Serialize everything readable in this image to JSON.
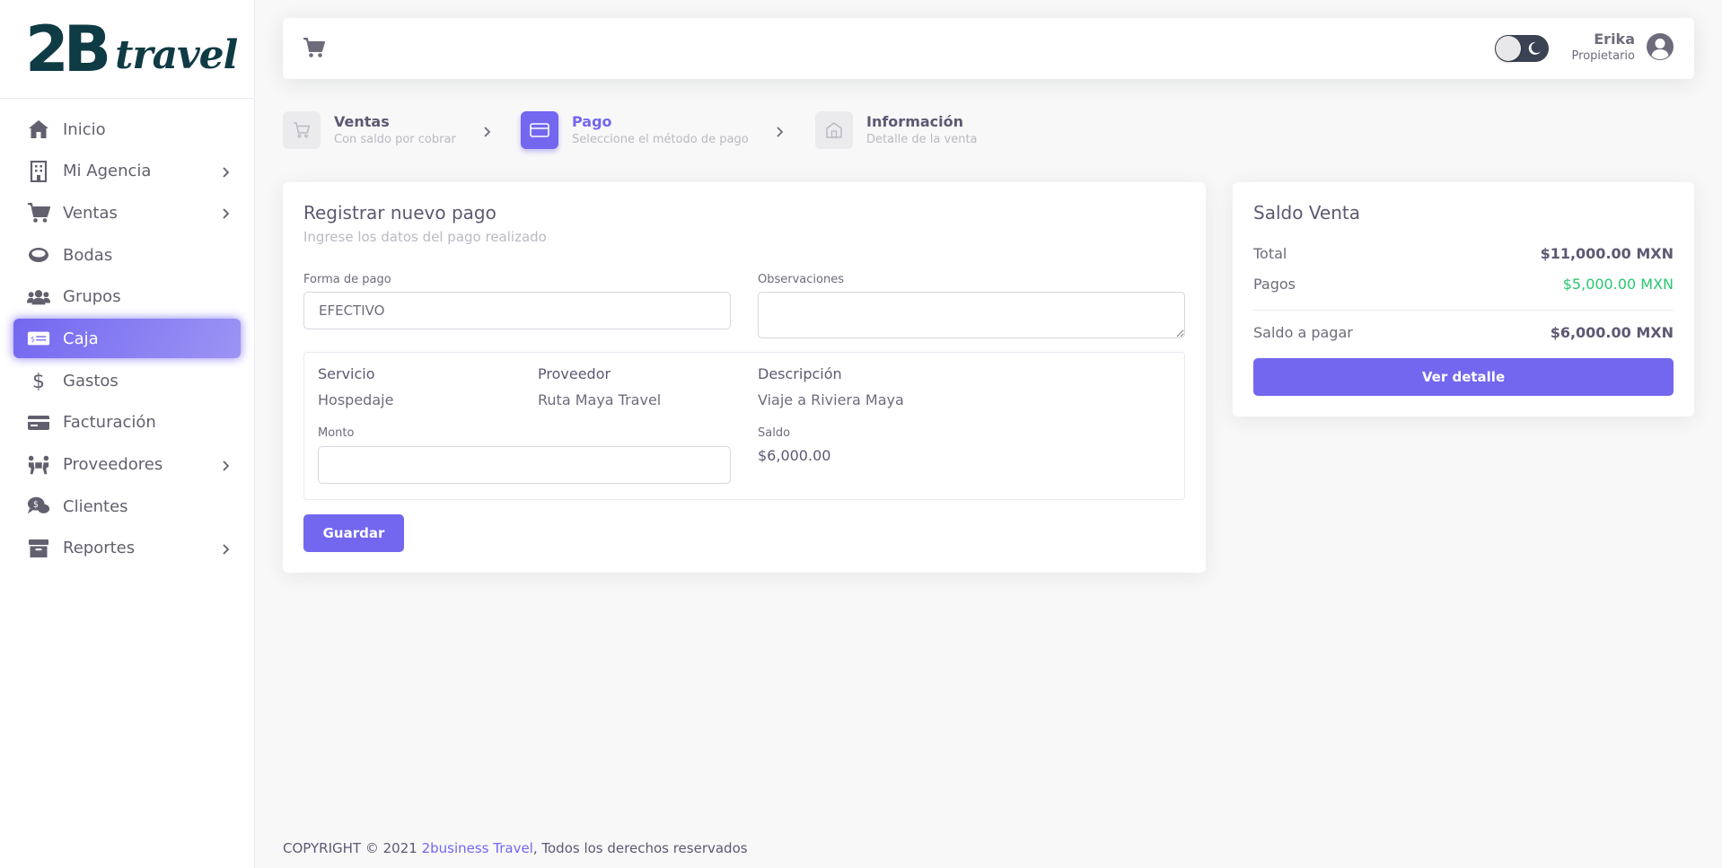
{
  "brand": {
    "logo_main": "2B",
    "logo_sub": "travel"
  },
  "sidebar": {
    "items": [
      {
        "label": "Inicio",
        "icon": "home-icon",
        "has_submenu": false
      },
      {
        "label": "Mi Agencia",
        "icon": "building-icon",
        "has_submenu": true
      },
      {
        "label": "Ventas",
        "icon": "cart-icon",
        "has_submenu": true
      },
      {
        "label": "Bodas",
        "icon": "ring-icon",
        "has_submenu": false
      },
      {
        "label": "Grupos",
        "icon": "users-icon",
        "has_submenu": false
      },
      {
        "label": "Caja",
        "icon": "money-bill-icon",
        "has_submenu": false,
        "active": true
      },
      {
        "label": "Gastos",
        "icon": "dollar-icon",
        "has_submenu": false
      },
      {
        "label": "Facturación",
        "icon": "credit-card-icon",
        "has_submenu": false
      },
      {
        "label": "Proveedores",
        "icon": "people-carry-icon",
        "has_submenu": true
      },
      {
        "label": "Clientes",
        "icon": "comments-dollar-icon",
        "has_submenu": false
      },
      {
        "label": "Reportes",
        "icon": "archive-icon",
        "has_submenu": true
      }
    ]
  },
  "navbar": {
    "cart_icon": "shopping-cart-icon",
    "user_name": "Erika",
    "user_role": "Propietario",
    "theme_toggle_icon": "moon-icon"
  },
  "stepper": {
    "steps": [
      {
        "title": "Ventas",
        "subtitle": "Con saldo por cobrar",
        "icon": "cart-outline-icon",
        "active": false
      },
      {
        "title": "Pago",
        "subtitle": "Seleccione el método de pago",
        "icon": "credit-card-outline-icon",
        "active": true
      },
      {
        "title": "Información",
        "subtitle": "Detalle de la venta",
        "icon": "home-outline-icon",
        "active": false
      }
    ]
  },
  "payment_form": {
    "title": "Registrar nuevo pago",
    "subtitle": "Ingrese los datos del pago realizado",
    "forma_label": "Forma de pago",
    "forma_value": "EFECTIVO",
    "obs_label": "Observaciones",
    "obs_value": "",
    "detail": {
      "servicio_head": "Servicio",
      "servicio_value": "Hospedaje",
      "proveedor_head": "Proveedor",
      "proveedor_value": "Ruta Maya Travel",
      "descripcion_head": "Descripción",
      "descripcion_value": "Viaje a Riviera Maya",
      "monto_label": "Monto",
      "monto_value": "",
      "saldo_label": "Saldo",
      "saldo_value": "$6,000.00"
    },
    "save_label": "Guardar"
  },
  "saldo_venta": {
    "title": "Saldo Venta",
    "total_label": "Total",
    "total_value": "$11,000.00 MXN",
    "pagos_label": "Pagos",
    "pagos_value": "$5,000.00 MXN",
    "saldo_label": "Saldo a pagar",
    "saldo_value": "$6,000.00 MXN",
    "detail_button": "Ver detalle"
  },
  "footer": {
    "prefix": "COPYRIGHT © 2021 ",
    "link": "2business Travel",
    "suffix": ", Todos los derechos reservados"
  },
  "colors": {
    "primary": "#7367f0",
    "success": "#28c76f",
    "logo": "#0f3b45"
  }
}
